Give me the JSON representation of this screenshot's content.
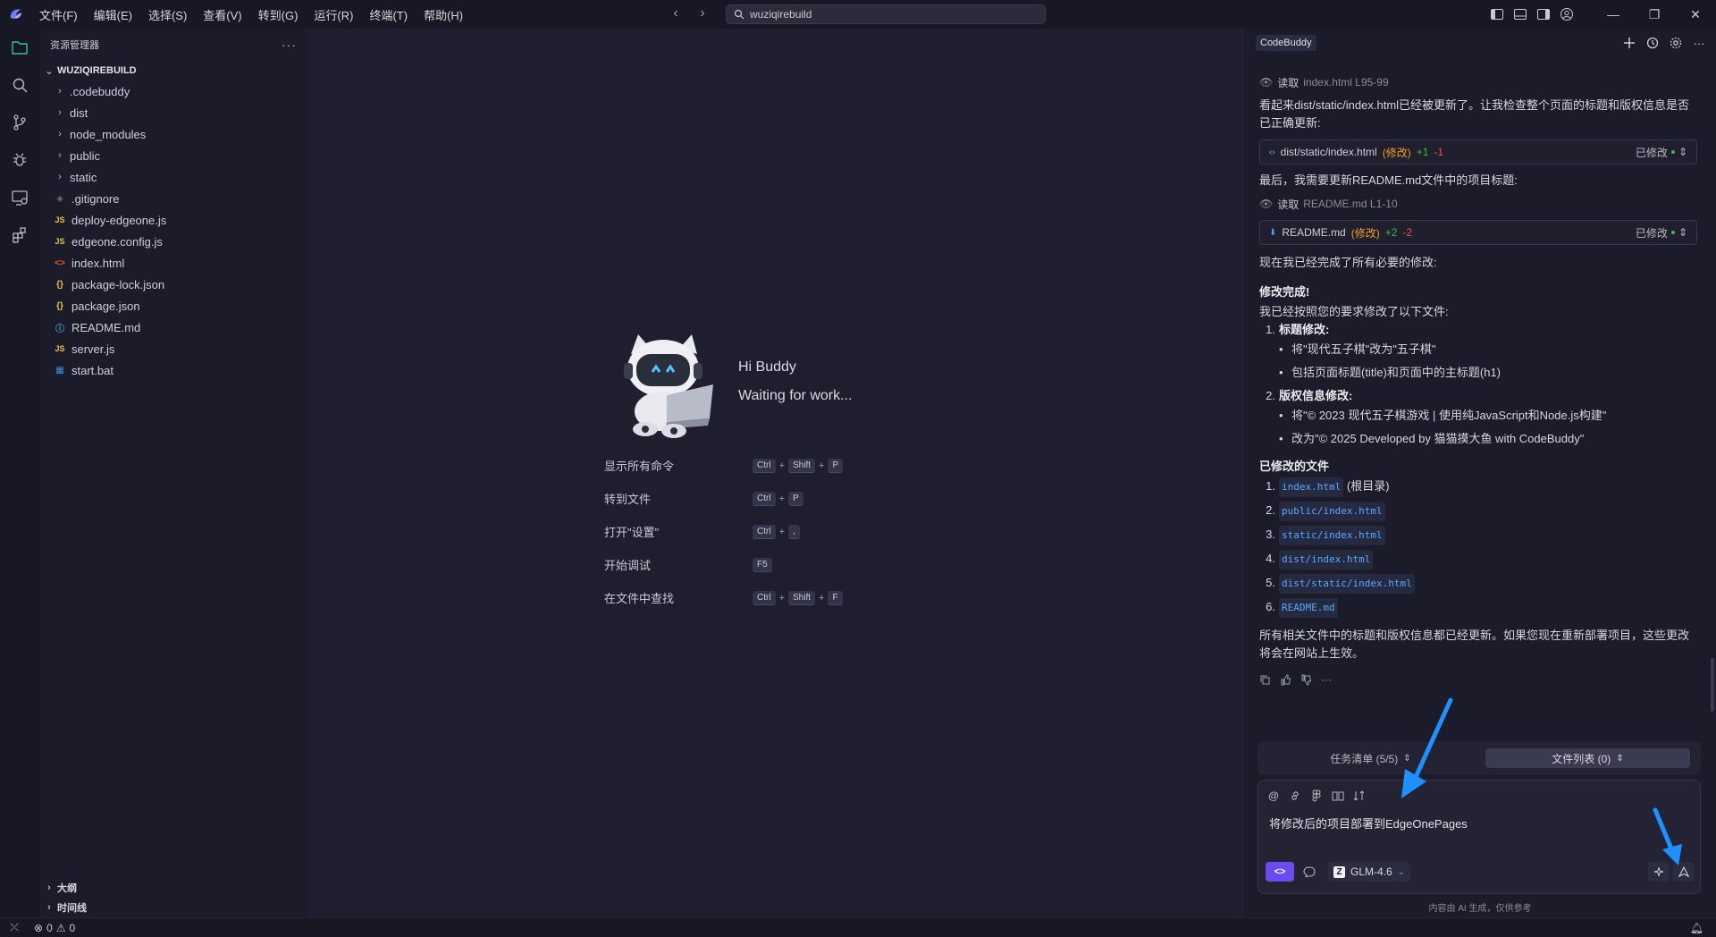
{
  "menu": [
    "文件(F)",
    "编辑(E)",
    "选择(S)",
    "查看(V)",
    "转到(G)",
    "运行(R)",
    "终端(T)",
    "帮助(H)"
  ],
  "search": {
    "value": "wuziqirebuild"
  },
  "explorer": {
    "title": "资源管理器",
    "root": "WUZIQIREBUILD",
    "folders": [
      ".codebuddy",
      "dist",
      "node_modules",
      "public",
      "static"
    ],
    "files": [
      {
        "name": ".gitignore",
        "icon": "git-icon"
      },
      {
        "name": "deploy-edgeone.js",
        "icon": "js-icon"
      },
      {
        "name": "edgeone.config.js",
        "icon": "js-icon"
      },
      {
        "name": "index.html",
        "icon": "html-icon"
      },
      {
        "name": "package-lock.json",
        "icon": "json-icon"
      },
      {
        "name": "package.json",
        "icon": "json-icon"
      },
      {
        "name": "README.md",
        "icon": "info-icon"
      },
      {
        "name": "server.js",
        "icon": "js-icon"
      },
      {
        "name": "start.bat",
        "icon": "windows-icon"
      }
    ],
    "outline": "大纲",
    "timeline": "时间线"
  },
  "welcome": {
    "hi": "Hi Buddy",
    "waiting": "Waiting for work...",
    "shortcuts": [
      {
        "label": "显示所有命令",
        "keys": [
          "Ctrl",
          "Shift",
          "P"
        ]
      },
      {
        "label": "转到文件",
        "keys": [
          "Ctrl",
          "P"
        ]
      },
      {
        "label": "打开\"设置\"",
        "keys": [
          "Ctrl",
          ","
        ]
      },
      {
        "label": "开始调试",
        "keys": [
          "F5"
        ]
      },
      {
        "label": "在文件中查找",
        "keys": [
          "Ctrl",
          "Shift",
          "F"
        ]
      }
    ]
  },
  "chat": {
    "tab": "CodeBuddy",
    "read1": {
      "verb": "读取",
      "target": "index.html L95-99"
    },
    "para1": "看起来dist/static/index.html已经被更新了。让我检查整个页面的标题和版权信息是否已正确更新:",
    "diff1": {
      "file": "dist/static/index.html",
      "tag": "(修改)",
      "add": "+1",
      "del": "-1",
      "status": "已修改"
    },
    "para2": "最后，我需要更新README.md文件中的项目标题:",
    "read2": {
      "verb": "读取",
      "target": "README.md L1-10"
    },
    "diff2": {
      "file": "README.md",
      "tag": "(修改)",
      "add": "+2",
      "del": "-2",
      "status": "已修改"
    },
    "para3": "现在我已经完成了所有必要的修改:",
    "done_title": "修改完成!",
    "done_intro": "我已经按照您的要求修改了以下文件:",
    "item1_title": "标题修改:",
    "item1_b1": "将\"现代五子棋\"改为\"五子棋\"",
    "item1_b2": "包括页面标题(title)和页面中的主标题(h1)",
    "item2_title": "版权信息修改:",
    "item2_b1": "将\"© 2023 现代五子棋游戏 | 使用纯JavaScript和Node.js构建\"",
    "item2_b2": "改为\"© 2025 Developed by 猫猫摸大鱼 with CodeBuddy\"",
    "modified_title": "已修改的文件",
    "modified_files": [
      "index.html",
      "public/index.html",
      "static/index.html",
      "dist/index.html",
      "dist/static/index.html",
      "README.md"
    ],
    "root_note": "(根目录)",
    "closing": "所有相关文件中的标题和版权信息都已经更新。如果您现在重新部署项目，这些更改将会在网站上生效。",
    "task_tab": "任务清单 (5/5)",
    "file_tab": "文件列表 (0)",
    "input_value": "将修改后的项目部署到EdgeOnePages",
    "model": "GLM-4.6",
    "disclaimer": "内容由 AI 生成，仅供参考"
  },
  "status": {
    "errors": "0",
    "warnings": "0"
  },
  "colors": {
    "accent": "#6c4cf0",
    "arrow": "#1e90ff"
  }
}
